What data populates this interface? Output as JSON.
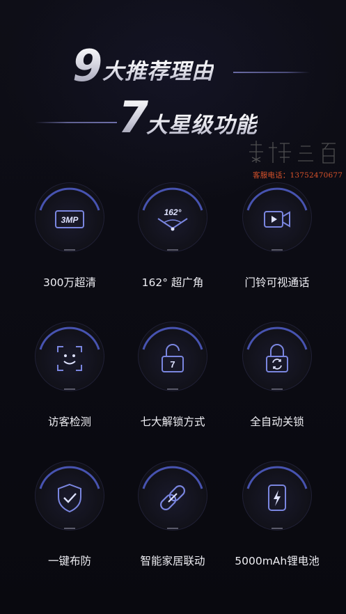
{
  "headline": {
    "line1_number": "9",
    "line1_text": "大推荐理由",
    "line2_number": "7",
    "line2_text": "大星级功能"
  },
  "watermark": {
    "seal_text": "奉橘三百",
    "phone": "客服电话：13752470677"
  },
  "features": [
    {
      "label": "300万超清",
      "icon": "3mp-icon",
      "icon_text": "3MP"
    },
    {
      "label": "162° 超广角",
      "icon": "wide-angle-icon",
      "icon_text": "162°"
    },
    {
      "label": "门铃可视通话",
      "icon": "video-call-icon"
    },
    {
      "label": "访客检测",
      "icon": "face-detect-icon"
    },
    {
      "label": "七大解锁方式",
      "icon": "unlock-icon",
      "icon_text": "7"
    },
    {
      "label": "全自动关锁",
      "icon": "auto-lock-icon"
    },
    {
      "label": "一键布防",
      "icon": "shield-icon"
    },
    {
      "label": "智能家居联动",
      "icon": "link-icon"
    },
    {
      "label": "5000mAh锂电池",
      "icon": "battery-icon"
    }
  ],
  "colors": {
    "background": "#0b0b12",
    "icon_stroke": "#6f7bd8",
    "arc_glow": "#5564d6",
    "watermark_red": "#d9522a"
  }
}
